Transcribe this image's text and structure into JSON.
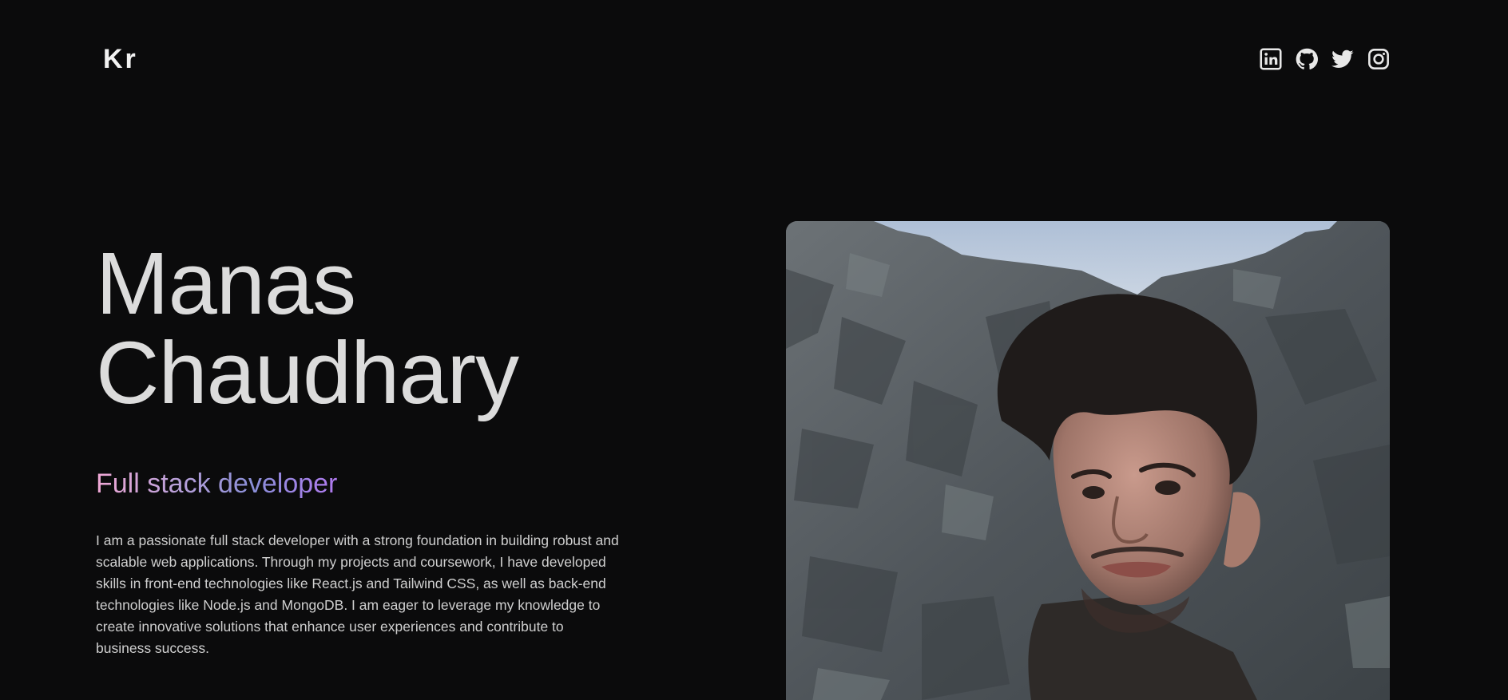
{
  "header": {
    "logo": "Kr",
    "socials": [
      {
        "icon": "linkedin-icon"
      },
      {
        "icon": "github-icon"
      },
      {
        "icon": "twitter-icon"
      },
      {
        "icon": "instagram-icon"
      }
    ]
  },
  "hero": {
    "first_name": "Manas",
    "last_name": "Chaudhary",
    "role": "Full stack developer",
    "bio": "I am a passionate full stack developer with a strong foundation in building robust and scalable web applications. Through my projects and coursework, I have developed skills in front-end technologies like React.js and Tailwind CSS, as well as back-end technologies like Node.js and MongoDB. I am eager to leverage my knowledge to create innovative solutions that enhance user experiences and contribute to business success."
  },
  "colors": {
    "background": "#0b0b0c",
    "text": "#dcdcdc",
    "gradient_start": "#f0a8d6",
    "gradient_end": "#b07af0"
  }
}
